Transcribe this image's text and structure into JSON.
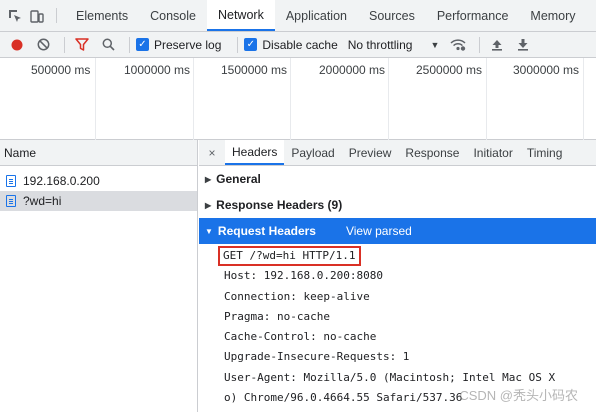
{
  "tabbar": {
    "tabs": [
      {
        "label": "Elements"
      },
      {
        "label": "Console"
      },
      {
        "label": "Network"
      },
      {
        "label": "Application"
      },
      {
        "label": "Sources"
      },
      {
        "label": "Performance"
      },
      {
        "label": "Memory"
      }
    ],
    "active_tab": "Network",
    "icons": [
      "inspect-element-icon",
      "device-toggle-icon"
    ]
  },
  "toolbar": {
    "preserve_log_label": "Preserve log",
    "preserve_log_checked": true,
    "disable_cache_label": "Disable cache",
    "disable_cache_checked": true,
    "throttling_value": "No throttling",
    "icons": [
      "record-icon",
      "clear-icon",
      "filter-icon",
      "search-icon",
      "network-conditions-icon",
      "import-icon",
      "export-icon"
    ],
    "colors": {
      "record": "#d93025",
      "filter": "#d93025",
      "accent": "#1a73e8"
    }
  },
  "overview": {
    "ticks": [
      "500000 ms",
      "1000000 ms",
      "1500000 ms",
      "2000000 ms",
      "2500000 ms",
      "3000000 ms"
    ]
  },
  "requests": {
    "column_name": "Name",
    "items": [
      {
        "name": "192.168.0.200",
        "selected": false
      },
      {
        "name": "?wd=hi",
        "selected": true
      }
    ]
  },
  "detail": {
    "close_symbol": "×",
    "tabs": [
      {
        "label": "Headers"
      },
      {
        "label": "Payload"
      },
      {
        "label": "Preview"
      },
      {
        "label": "Response"
      },
      {
        "label": "Initiator"
      },
      {
        "label": "Timing"
      }
    ],
    "active_tab": "Headers",
    "sections": {
      "general": "General",
      "response_headers": "Response Headers (9)",
      "request_headers": "Request Headers",
      "view_parsed": "View parsed"
    },
    "request_lines": [
      "GET /?wd=hi HTTP/1.1",
      "Host: 192.168.0.200:8080",
      "Connection: keep-alive",
      "Pragma: no-cache",
      "Cache-Control: no-cache",
      "Upgrade-Insecure-Requests: 1",
      "User-Agent: Mozilla/5.0 (Macintosh; Intel Mac OS X",
      "o) Chrome/96.0.4664.55 Safari/537.36"
    ],
    "highlight_color": "#d93025"
  },
  "watermark": "CSDN @秃头小码农"
}
